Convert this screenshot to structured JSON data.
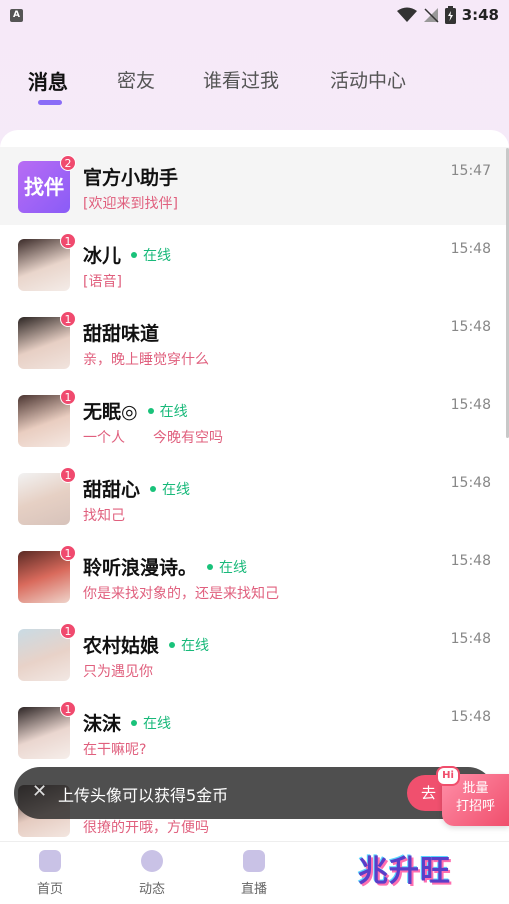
{
  "status_bar": {
    "app_icon": "A",
    "time": "3:48"
  },
  "tabs": [
    "消息",
    "密友",
    "谁看过我",
    "活动中心"
  ],
  "conversations": [
    {
      "name": "官方小助手",
      "badge": "2",
      "preview": "[欢迎来到找伴]",
      "time": "15:47",
      "avatar_text": "找伴",
      "online": ""
    },
    {
      "name": "冰儿",
      "badge": "1",
      "preview": "[语音]",
      "time": "15:48",
      "online": "在线"
    },
    {
      "name": "甜甜味道",
      "badge": "1",
      "preview": "亲，晚上睡觉穿什么",
      "time": "15:48",
      "online": ""
    },
    {
      "name": "无眠◎",
      "badge": "1",
      "preview": "一个人　　今晚有空吗",
      "time": "15:48",
      "online": "在线"
    },
    {
      "name": "甜甜心",
      "badge": "1",
      "preview": "找知己",
      "time": "15:48",
      "online": "在线"
    },
    {
      "name": "聆听浪漫诗。",
      "badge": "1",
      "preview": "你是来找对象的，还是来找知己",
      "time": "15:48",
      "online": "在线"
    },
    {
      "name": "农村姑娘",
      "badge": "1",
      "preview": "只为遇见你",
      "time": "15:48",
      "online": "在线"
    },
    {
      "name": "沫沫",
      "badge": "1",
      "preview": "在干嘛呢?",
      "time": "15:48",
      "online": "在线"
    },
    {
      "name": "",
      "badge": "",
      "preview": "很撩的开哦，方便吗",
      "time": "",
      "online": ""
    }
  ],
  "toast": {
    "text": "上传头像可以获得5金币",
    "button": "去"
  },
  "greet_button": {
    "hi": "Hi",
    "line1": "批量",
    "line2": "打招呼"
  },
  "bottom_nav": [
    "首页",
    "动态",
    "直播"
  ],
  "brand": "兆升旺",
  "colors": {
    "accent": "#8a6cf7",
    "online": "#19b97a",
    "preview": "#e0607e",
    "badge": "#f04a6e"
  }
}
